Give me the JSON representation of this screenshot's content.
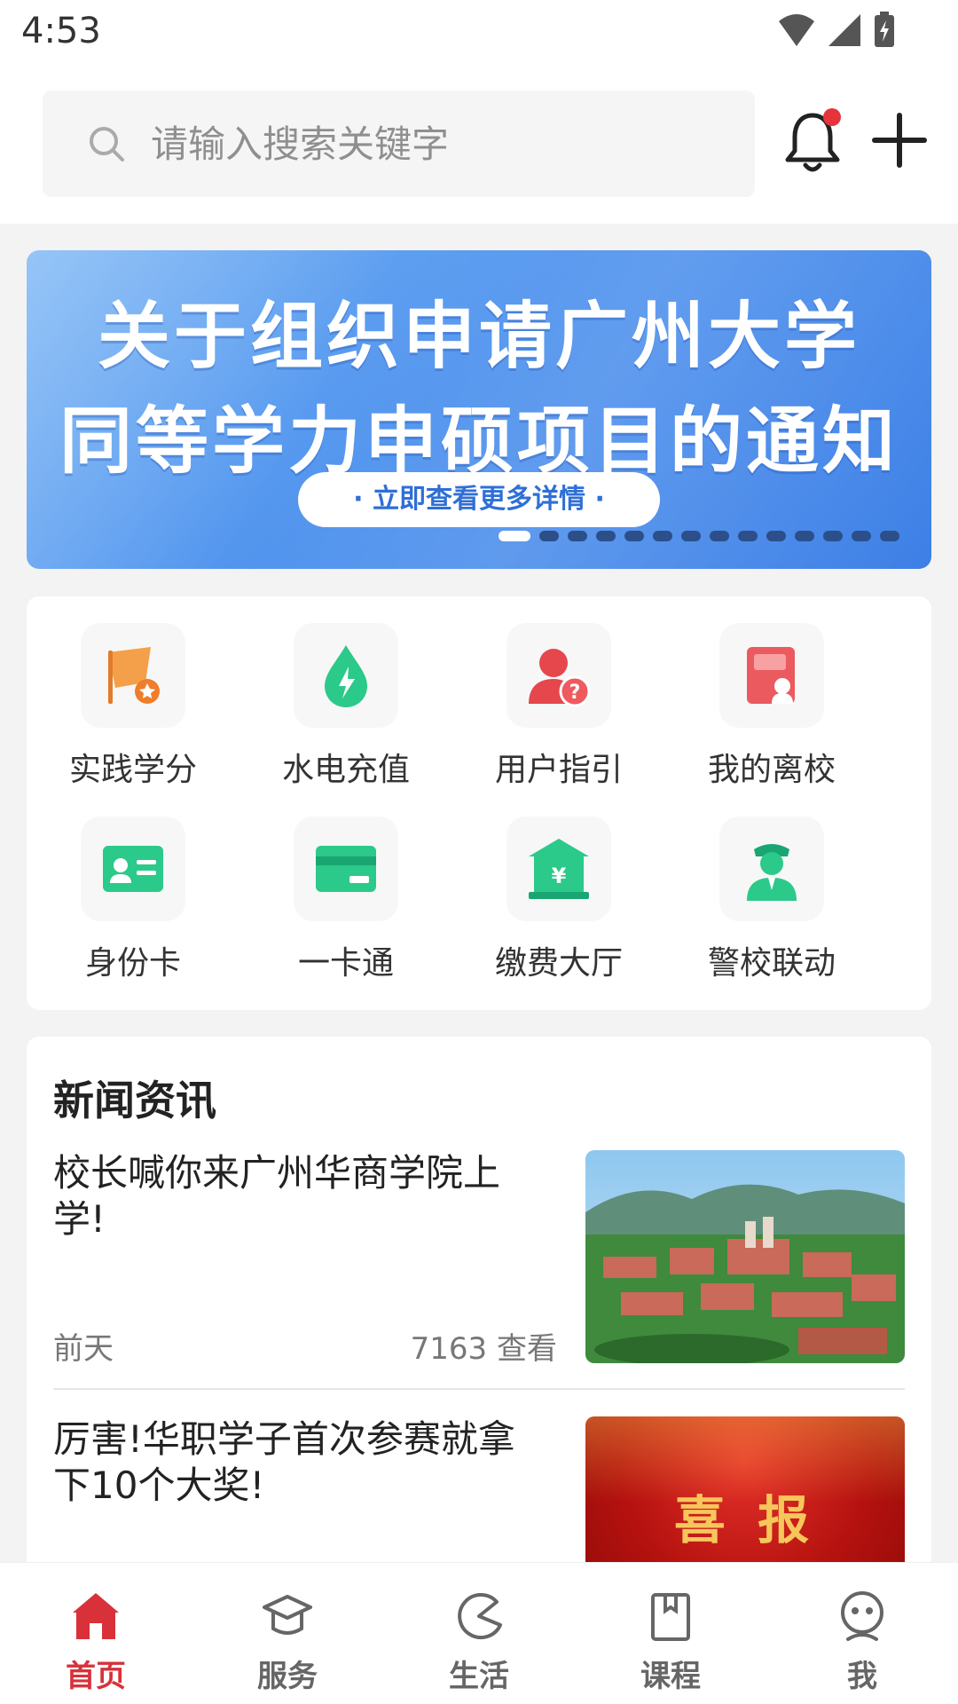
{
  "status": {
    "time": "4:53"
  },
  "search": {
    "placeholder": "请输入搜索关键字"
  },
  "banner": {
    "line1": "关于组织申请广州大学",
    "line2": "同等学力申硕项目的通知",
    "button": "· 立即查看更多详情 ·",
    "page_count": 14,
    "active_index": 0
  },
  "services": [
    {
      "label": "实践学分",
      "icon": "flag-star-icon"
    },
    {
      "label": "水电充值",
      "icon": "water-drop-bolt-icon"
    },
    {
      "label": "用户指引",
      "icon": "user-help-icon"
    },
    {
      "label": "我的离校",
      "icon": "leave-school-icon"
    },
    {
      "label": "身份卡",
      "icon": "id-card-icon"
    },
    {
      "label": "一卡通",
      "icon": "campus-card-icon"
    },
    {
      "label": "缴费大厅",
      "icon": "payment-hall-icon"
    },
    {
      "label": "警校联动",
      "icon": "police-icon"
    }
  ],
  "news": {
    "title": "新闻资讯",
    "items": [
      {
        "headline": "校长喊你来广州华商学院上学!",
        "date": "前天",
        "views": "7163 查看"
      },
      {
        "headline": "厉害!华职学子首次参赛就拿下10个大奖!",
        "thumb_text": "喜 报"
      }
    ]
  },
  "tabs": [
    {
      "label": "首页",
      "icon": "home-icon",
      "active": true
    },
    {
      "label": "服务",
      "icon": "graduation-cap-icon",
      "active": false
    },
    {
      "label": "生活",
      "icon": "life-pie-icon",
      "active": false
    },
    {
      "label": "课程",
      "icon": "book-icon",
      "active": false
    },
    {
      "label": "我",
      "icon": "smiley-icon",
      "active": false
    }
  ],
  "colors": {
    "accent": "#d8313a",
    "banner_blue": "#4f93ee",
    "service_green": "#2bc98a",
    "service_orange": "#f08a3c",
    "service_red": "#e5474d"
  }
}
